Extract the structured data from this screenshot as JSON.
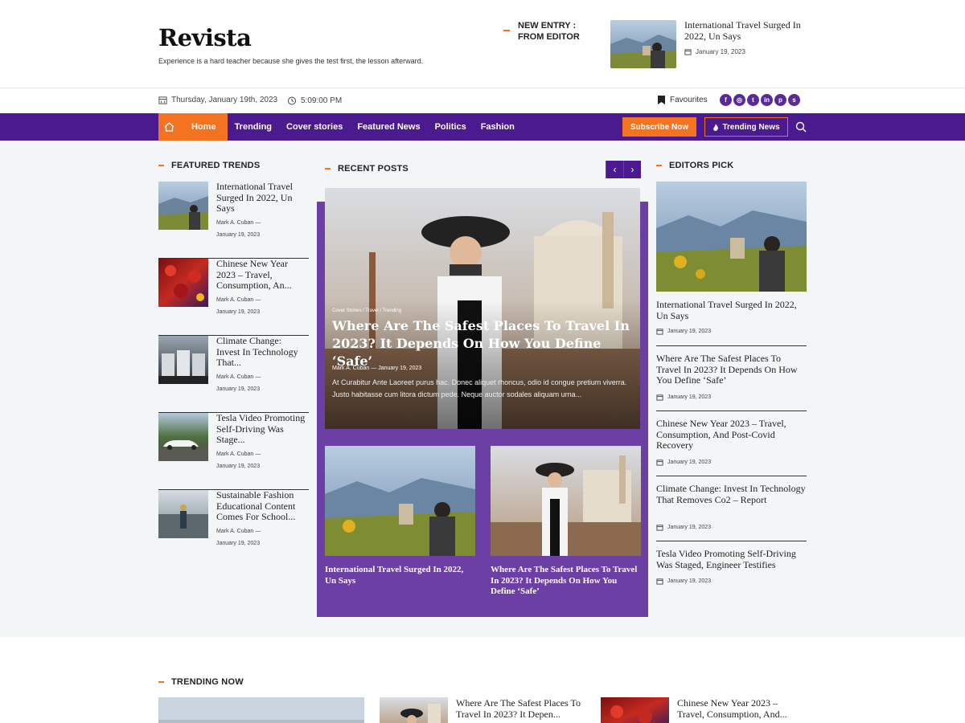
{
  "site": {
    "title": "Revista",
    "tagline": "Experience is a hard teacher because she gives the test first, the lesson afterward."
  },
  "new_entry": {
    "label": "NEW ENTRY : FROM EDITOR",
    "post_title": "International Travel Surged In 2022, Un Says",
    "post_date": "January 19, 2023"
  },
  "infobar": {
    "date": "Thursday, January 19th, 2023",
    "time": "5:09:00 PM",
    "favourites": "Favourites",
    "socials": [
      "facebook-icon",
      "instagram-icon",
      "twitter-icon",
      "linkedin-icon",
      "pinterest-icon",
      "skype-icon"
    ]
  },
  "nav": {
    "items": [
      "Home",
      "Trending",
      "Cover stories",
      "Featured News",
      "Politics",
      "Fashion"
    ],
    "subscribe": "Subscribe Now",
    "trending": "Trending News"
  },
  "featured_trends": {
    "title": "FEATURED TRENDS",
    "items": [
      {
        "title": "International Travel Surged In 2022, Un Says",
        "author": "Mark A. Cuban",
        "date": "January 19, 2023"
      },
      {
        "title": "Chinese New Year 2023 – Travel, Consumption, An...",
        "author": "Mark A. Cuban",
        "date": "January 19, 2023"
      },
      {
        "title": "Climate Change: Invest In Technology That...",
        "author": "Mark A. Cuban",
        "date": "January 19, 2023"
      },
      {
        "title": "Tesla Video Promoting Self-Driving Was Stage...",
        "author": "Mark A. Cuban",
        "date": "January 19, 2023"
      },
      {
        "title": "Sustainable Fashion Educational Content Comes For School...",
        "author": "Mark A. Cuban",
        "date": "January 19, 2023"
      }
    ]
  },
  "recent_posts": {
    "title": "RECENT POSTS",
    "hero": {
      "categories": "Cover Stories / Travel / Trending",
      "title": "Where Are The Safest Places To Travel In 2023? It Depends On How You Define ‘Safe’",
      "author": "Mark A. Cuban",
      "date": "January 19, 2023",
      "excerpt": "At Curabitur Ante Laoreet purus hac. Donec aliquet rhoncus, odio id congue pretium viverra. Justo habitasse cum litora dictum pede. Neque auctor sodales aliquam urna..."
    },
    "cards": [
      {
        "title": "International Travel Surged In 2022, Un Says"
      },
      {
        "title": "Where Are The Safest Places To Travel In 2023? It Depends On How You Define ‘Safe’"
      }
    ]
  },
  "editors_pick": {
    "title": "EDITORS PICK",
    "featured": {
      "title": "International Travel Surged In 2022, Un Says",
      "date": "January 19, 2023"
    },
    "items": [
      {
        "title": "Where Are The Safest Places To Travel In 2023? It Depends On How You Define ‘Safe’",
        "date": "January 19, 2023"
      },
      {
        "title": "Chinese New Year 2023 – Travel, Consumption, And Post-Covid Recovery",
        "date": "January 19, 2023"
      },
      {
        "title": "Climate Change: Invest In Technology That Removes Co2 – Report",
        "date": "January 19, 2023"
      },
      {
        "title": "Tesla Video Promoting Self-Driving Was Staged, Engineer Testifies",
        "date": "January 19, 2023"
      }
    ]
  },
  "trending_now": {
    "title": "TRENDING NOW",
    "items": [
      {
        "title": "Where Are The Safest Places To Travel In 2023? It Depen..."
      },
      {
        "title": "Chinese New Year 2023 – Travel, Consumption, And..."
      }
    ]
  },
  "colors": {
    "accent": "#f47321",
    "brand_purple": "#4b1a8e",
    "panel_purple": "#6b3fa4"
  }
}
